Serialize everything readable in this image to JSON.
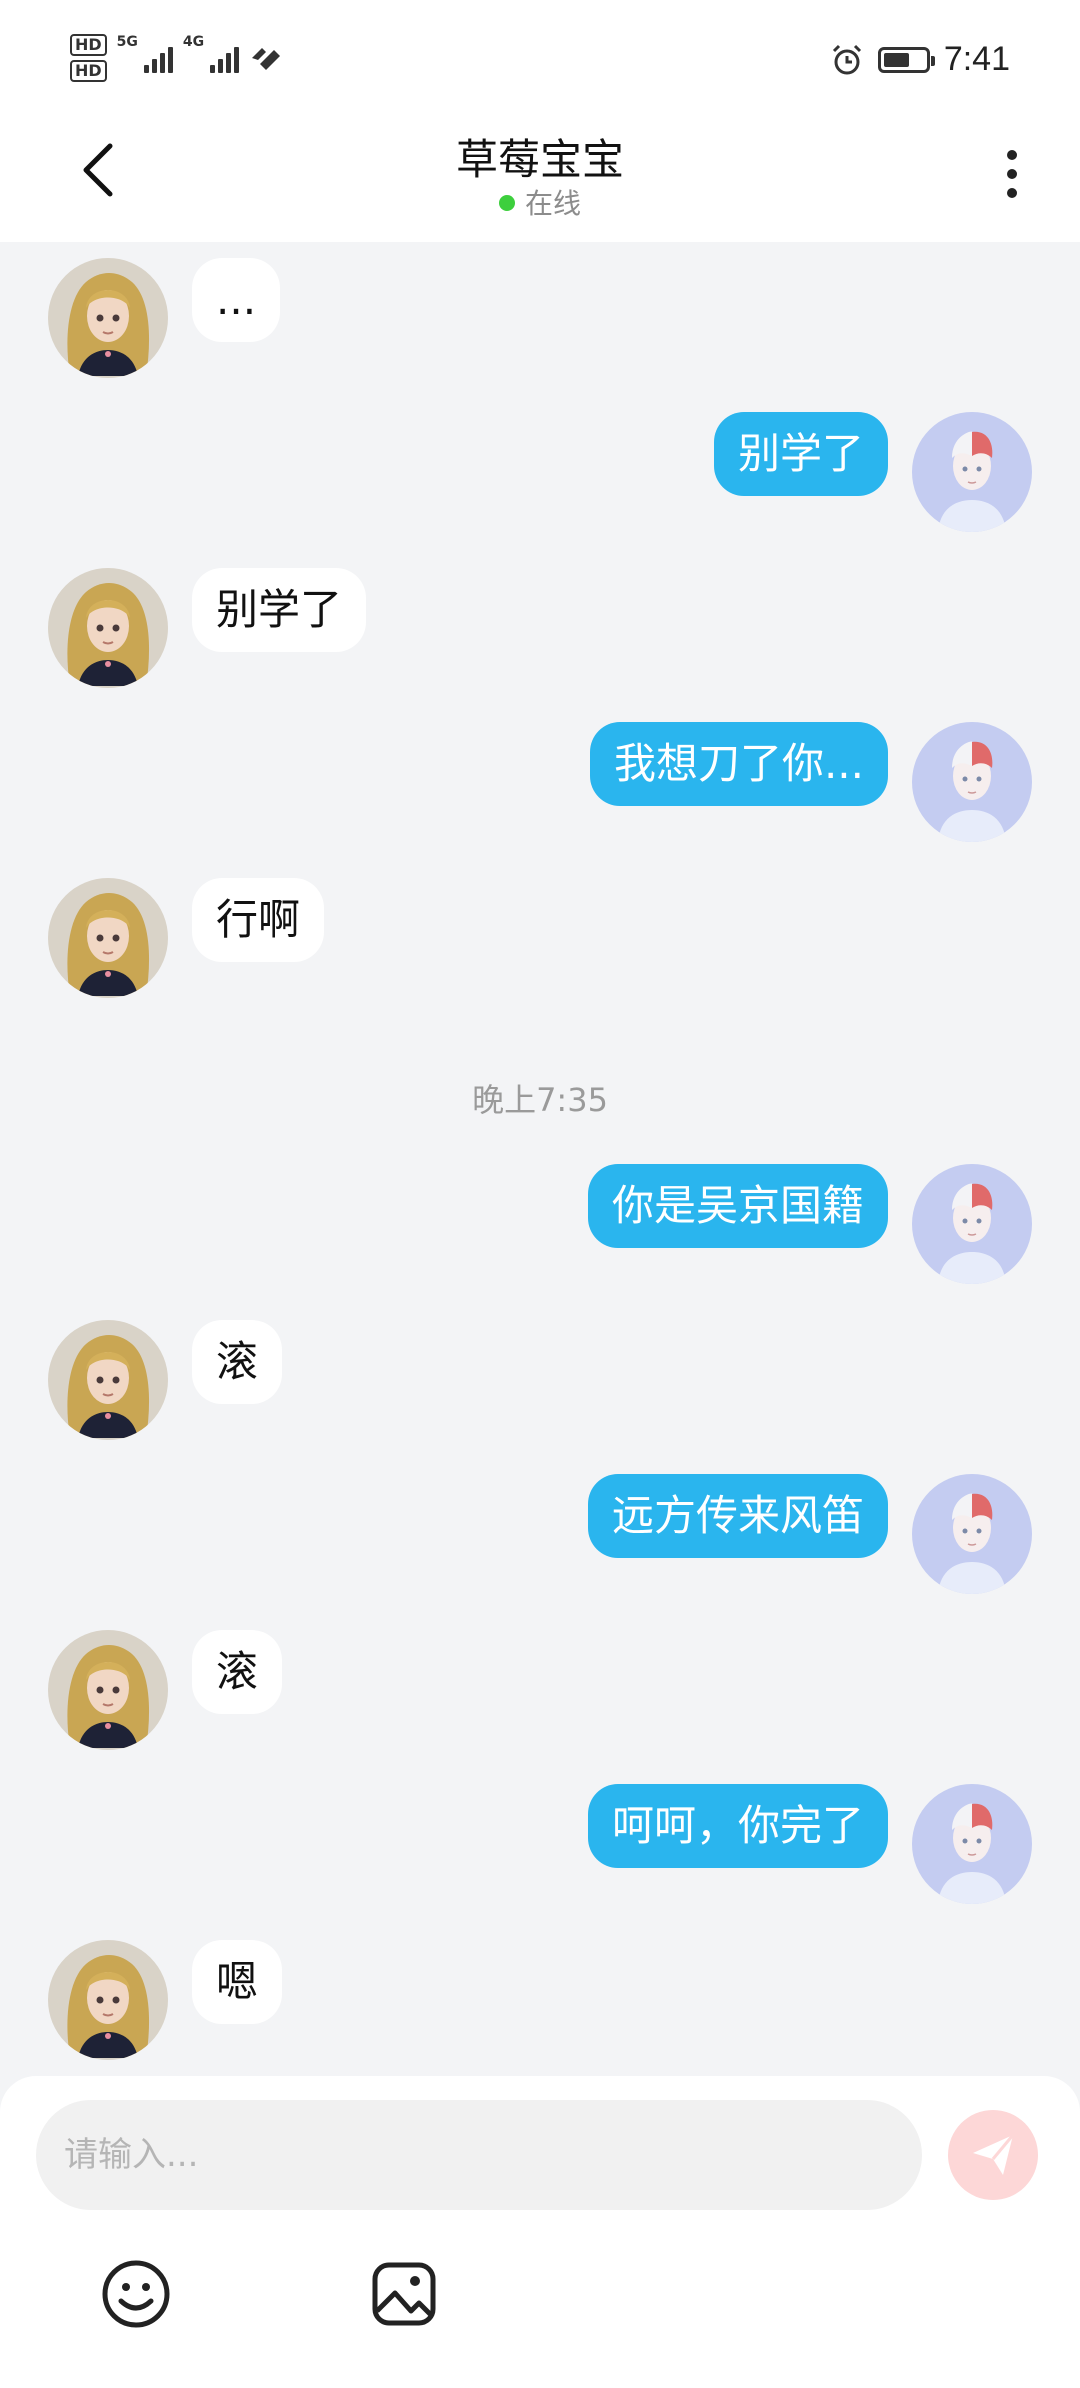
{
  "status_bar": {
    "hd1": "HD",
    "hd2": "HD",
    "net1": "5G",
    "net2": "4G",
    "time": "7:41"
  },
  "header": {
    "title": "草莓宝宝",
    "status": "在线",
    "back_icon": "chevron-left-icon",
    "more_icon": "more-vertical-icon",
    "online_color": "#3dcf3d"
  },
  "messages": [
    {
      "side": "in",
      "text": "..."
    },
    {
      "side": "out",
      "text": "别学了"
    },
    {
      "side": "in",
      "text": "别学了"
    },
    {
      "side": "out",
      "text": "我想刀了你..."
    },
    {
      "side": "in",
      "text": "行啊"
    },
    {
      "side": "time",
      "text": "晚上7:35"
    },
    {
      "side": "out",
      "text": "你是吴京国籍"
    },
    {
      "side": "in",
      "text": "滚"
    },
    {
      "side": "out",
      "text": "远方传来风笛"
    },
    {
      "side": "in",
      "text": "滚"
    },
    {
      "side": "out",
      "text": "呵呵，你完了"
    },
    {
      "side": "in",
      "text": "嗯"
    }
  ],
  "input": {
    "placeholder": "请输入...",
    "value": ""
  },
  "toolbar": {
    "emoji_icon": "emoji-icon",
    "image_icon": "image-icon",
    "send_icon": "send-icon"
  },
  "colors": {
    "outgoing_bubble": "#2ab5ee",
    "incoming_bubble": "#ffffff",
    "background": "#f3f4f6",
    "send_button": "#fdd7d7"
  }
}
